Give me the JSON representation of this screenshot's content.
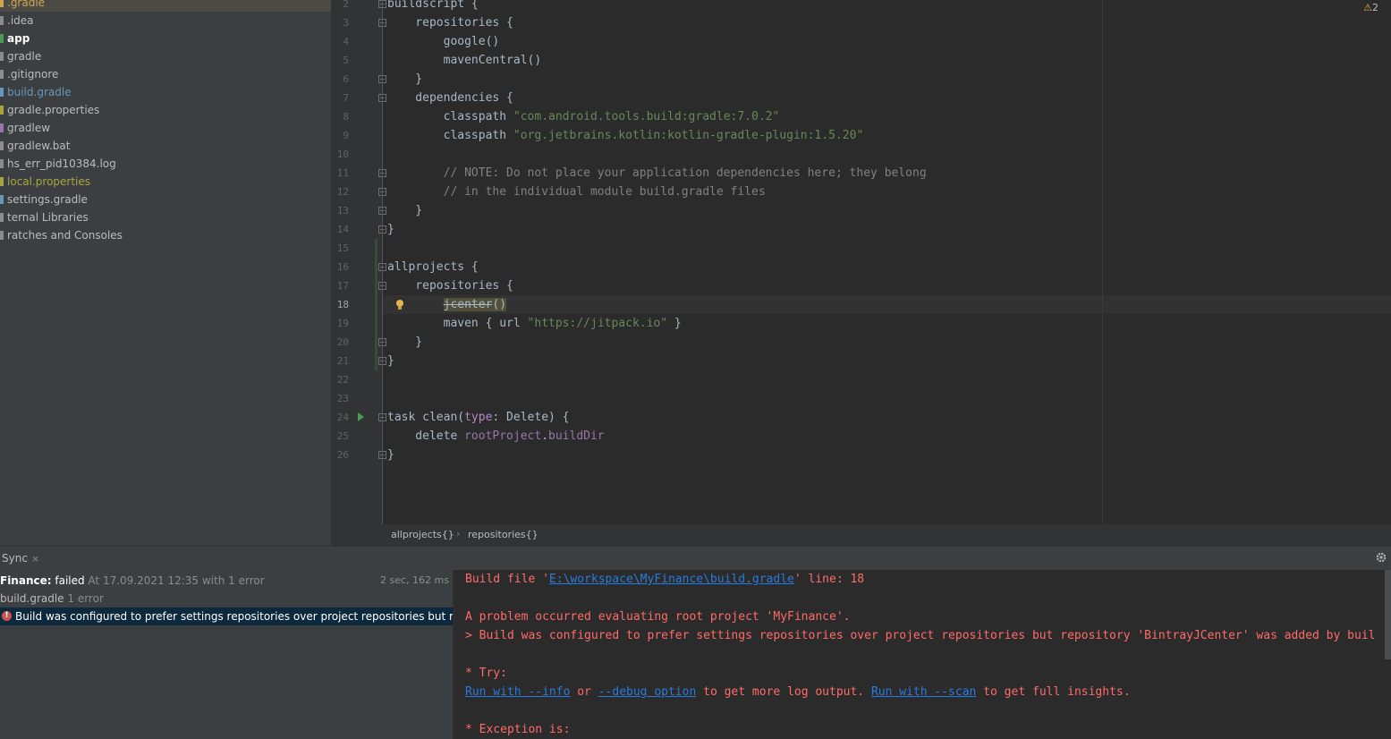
{
  "project_tree": {
    "items": [
      {
        "label": ".gradle",
        "color": "#d0a54f",
        "icon": "folder-icon"
      },
      {
        "label": ".idea",
        "color": "#bbbbbb",
        "icon": "folder-icon"
      },
      {
        "label": "app",
        "color": "#ffffff",
        "icon": "module-folder-icon"
      },
      {
        "label": "gradle",
        "color": "#bbbbbb",
        "icon": "folder-icon"
      },
      {
        "label": ".gitignore",
        "color": "#bbbbbb",
        "icon": "file-icon"
      },
      {
        "label": "build.gradle",
        "color": "#6897bb",
        "icon": "gradle-file-icon"
      },
      {
        "label": "gradle.properties",
        "color": "#bbbbbb",
        "icon": "properties-file-icon"
      },
      {
        "label": "gradlew",
        "color": "#bbbbbb",
        "icon": "script-file-icon"
      },
      {
        "label": "gradlew.bat",
        "color": "#bbbbbb",
        "icon": "file-icon"
      },
      {
        "label": "hs_err_pid10384.log",
        "color": "#bbbbbb",
        "icon": "log-file-icon"
      },
      {
        "label": "local.properties",
        "color": "#a8a53e",
        "icon": "properties-file-icon"
      },
      {
        "label": "settings.gradle",
        "color": "#bbbbbb",
        "icon": "gradle-file-icon"
      },
      {
        "label": "ternal Libraries",
        "color": "#bbbbbb",
        "icon": "library-icon"
      },
      {
        "label": "ratches and Consoles",
        "color": "#bbbbbb",
        "icon": "scratch-icon"
      }
    ]
  },
  "editor": {
    "warning_count": "2",
    "current_line": "18",
    "lines": [
      {
        "n": "2",
        "segs": [
          {
            "t": "buildscript {",
            "c": ""
          }
        ]
      },
      {
        "n": "3",
        "segs": [
          {
            "t": "    repositories {",
            "c": ""
          }
        ]
      },
      {
        "n": "4",
        "segs": [
          {
            "t": "        google()",
            "c": ""
          }
        ]
      },
      {
        "n": "5",
        "segs": [
          {
            "t": "        mavenCentral()",
            "c": ""
          }
        ]
      },
      {
        "n": "6",
        "segs": [
          {
            "t": "    }",
            "c": ""
          }
        ]
      },
      {
        "n": "7",
        "segs": [
          {
            "t": "    dependencies {",
            "c": ""
          }
        ]
      },
      {
        "n": "8",
        "segs": [
          {
            "t": "        classpath ",
            "c": ""
          },
          {
            "t": "\"com.android.tools.build:gradle:7.0.2\"",
            "c": "str"
          }
        ]
      },
      {
        "n": "9",
        "segs": [
          {
            "t": "        classpath ",
            "c": ""
          },
          {
            "t": "\"org.jetbrains.kotlin:kotlin-gradle-plugin:1.5.20\"",
            "c": "str"
          }
        ]
      },
      {
        "n": "10",
        "segs": []
      },
      {
        "n": "11",
        "segs": [
          {
            "t": "        // NOTE: Do not place your application dependencies here; they belong",
            "c": "cmt"
          }
        ]
      },
      {
        "n": "12",
        "segs": [
          {
            "t": "        // in the individual module build.gradle files",
            "c": "cmt"
          }
        ]
      },
      {
        "n": "13",
        "segs": [
          {
            "t": "    }",
            "c": ""
          }
        ]
      },
      {
        "n": "14",
        "segs": [
          {
            "t": "}",
            "c": ""
          }
        ]
      },
      {
        "n": "15",
        "segs": []
      },
      {
        "n": "16",
        "segs": [
          {
            "t": "allprojects {",
            "c": ""
          }
        ]
      },
      {
        "n": "17",
        "segs": [
          {
            "t": "    repositories {",
            "c": ""
          }
        ]
      },
      {
        "n": "18",
        "segs": [
          {
            "t": "        ",
            "c": ""
          },
          {
            "t": "jcenter",
            "c": "deprecated warn-underline"
          },
          {
            "t": "()",
            "c": "warn-underline"
          }
        ]
      },
      {
        "n": "19",
        "segs": [
          {
            "t": "        maven { url ",
            "c": ""
          },
          {
            "t": "\"https://jitpack.io\"",
            "c": "str"
          },
          {
            "t": " }",
            "c": ""
          }
        ]
      },
      {
        "n": "20",
        "segs": [
          {
            "t": "    }",
            "c": ""
          }
        ]
      },
      {
        "n": "21",
        "segs": [
          {
            "t": "}",
            "c": ""
          }
        ]
      },
      {
        "n": "22",
        "segs": []
      },
      {
        "n": "23",
        "segs": []
      },
      {
        "n": "24",
        "segs": [
          {
            "t": "task clean(",
            "c": ""
          },
          {
            "t": "type",
            "c": "param"
          },
          {
            "t": ": Delete) {",
            "c": ""
          }
        ]
      },
      {
        "n": "25",
        "segs": [
          {
            "t": "    delete ",
            "c": ""
          },
          {
            "t": "rootProject",
            "c": "prop"
          },
          {
            "t": ".",
            "c": ""
          },
          {
            "t": "buildDir",
            "c": "prop"
          }
        ]
      },
      {
        "n": "26",
        "segs": [
          {
            "t": "}",
            "c": ""
          }
        ]
      }
    ]
  },
  "breadcrumbs": [
    "allprojects{}",
    "repositories{}"
  ],
  "build_window": {
    "tab_label": "Sync",
    "tab_close": "×",
    "tree": {
      "root": {
        "name": "Finance:",
        "status": " failed",
        "detail": " At 17.09.2021 12:35 with 1 error",
        "duration": "2 sec, 162 ms"
      },
      "file": {
        "name": "build.gradle",
        "detail": " 1 error"
      },
      "error": {
        "text": "Build was configured to prefer settings repositories over project repositories but repository 'Bi"
      }
    },
    "output": [
      {
        "segs": [
          {
            "t": "Build file '",
            "k": "text"
          },
          {
            "t": "E:\\workspace\\MyFinance\\build.gradle",
            "k": "link"
          },
          {
            "t": "' line: 18",
            "k": "text"
          }
        ]
      },
      {
        "segs": []
      },
      {
        "segs": [
          {
            "t": "A problem occurred evaluating root project 'MyFinance'.",
            "k": "text"
          }
        ]
      },
      {
        "segs": [
          {
            "t": "> Build was configured to prefer settings repositories over project repositories but repository 'BintrayJCenter' was added by buil",
            "k": "text"
          }
        ]
      },
      {
        "segs": []
      },
      {
        "segs": [
          {
            "t": "* Try:",
            "k": "text"
          }
        ]
      },
      {
        "segs": [
          {
            "t": "Run with --info",
            "k": "link"
          },
          {
            "t": " or ",
            "k": "text"
          },
          {
            "t": "--debug option",
            "k": "link"
          },
          {
            "t": " to get more log output. ",
            "k": "text"
          },
          {
            "t": "Run with --scan",
            "k": "link"
          },
          {
            "t": " to get full insights.",
            "k": "text"
          }
        ]
      },
      {
        "segs": []
      },
      {
        "segs": [
          {
            "t": "* Exception is:",
            "k": "text"
          }
        ]
      }
    ]
  }
}
